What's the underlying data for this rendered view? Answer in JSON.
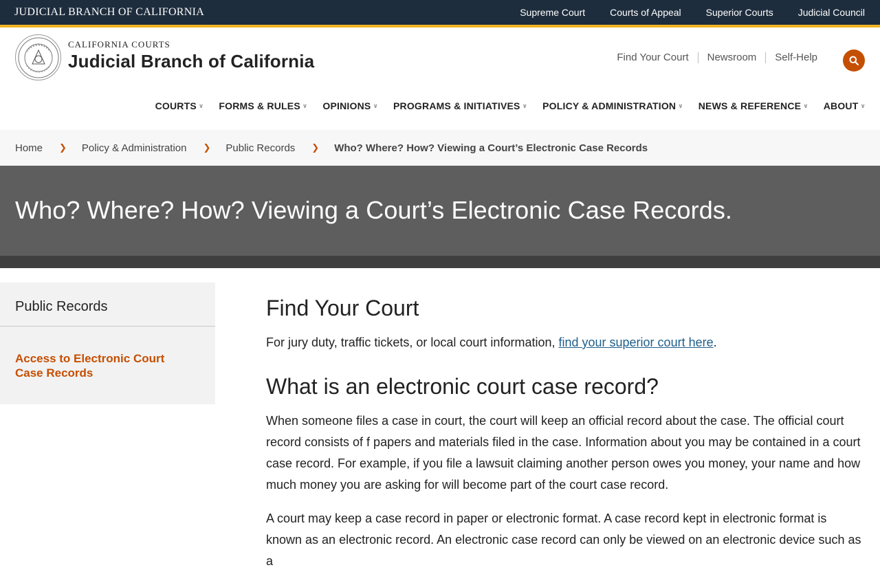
{
  "topbar": {
    "brand": "JUDICIAL BRANCH OF CALIFORNIA",
    "links": [
      "Supreme Court",
      "Courts of Appeal",
      "Superior Courts",
      "Judicial Council"
    ]
  },
  "header": {
    "logo_small": "CALIFORNIA COURTS",
    "logo_big": "Judicial Branch of California",
    "util_links": [
      "Find Your Court",
      "Newsroom",
      "Self-Help"
    ],
    "search_icon": "search-icon",
    "accent_color": "#c54f00"
  },
  "nav": {
    "items": [
      "COURTS",
      "FORMS & RULES",
      "OPINIONS",
      "PROGRAMS & INITIATIVES",
      "POLICY & ADMINISTRATION",
      "NEWS & REFERENCE",
      "ABOUT"
    ]
  },
  "breadcrumb": {
    "items": [
      "Home",
      "Policy & Administration",
      "Public Records"
    ],
    "current": "Who? Where? How? Viewing a Court’s Electronic Case Records"
  },
  "hero": {
    "title": "Who? Where? How? Viewing a Court’s Electronic Case Records."
  },
  "sidebar": {
    "title": "Public Records",
    "active_link": "Access to Electronic Court Case Records"
  },
  "content": {
    "h1": "Find Your Court",
    "p1_before": "For jury duty, traffic tickets, or local court information, ",
    "p1_link": "find your superior court here",
    "p1_after": ".",
    "h2": "What is an electronic court case record?",
    "p2": "When someone files a case in court, the court will keep an official record about the case. The official court record consists of f papers and materials filed in the case. Information about you may be contained in a court case record. For example, if you file a lawsuit claiming another person owes you money, your name and how much money you are asking for will become part of the court case record.",
    "p3": "A court may keep a case record in paper or electronic format. A case record kept in electronic format is known as an electronic record. An electronic case record can only be viewed on an electronic device such as a"
  }
}
